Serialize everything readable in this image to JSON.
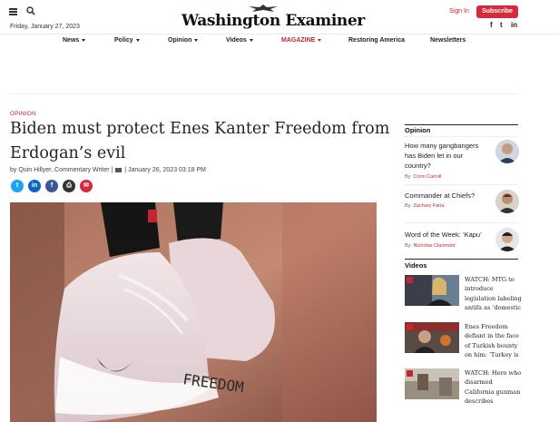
{
  "header": {
    "date": "Friday, January 27, 2023",
    "logo_text": "Washington Examiner",
    "sign_in": "Sign In",
    "subscribe": "Subscribe",
    "social": [
      "f",
      "t",
      "in"
    ]
  },
  "nav": {
    "items": [
      {
        "label": "News",
        "dropdown": true
      },
      {
        "label": "Policy",
        "dropdown": true
      },
      {
        "label": "Opinion",
        "dropdown": true
      },
      {
        "label": "Videos",
        "dropdown": true
      },
      {
        "label": "MAGAZINE",
        "dropdown": true
      },
      {
        "label": "Restoring America",
        "dropdown": false
      },
      {
        "label": "Newsletters",
        "dropdown": false
      }
    ]
  },
  "article": {
    "section": "OPINION",
    "headline": "Biden must protect Enes Kanter Freedom from Erdogan’s evil",
    "byline": "by Quin Hillyer, Commentary Writer |",
    "dateline": "| January 26, 2023 03:18 PM",
    "share": [
      {
        "icon": "twitter-icon",
        "glyph": "t",
        "color": "#1da1f2"
      },
      {
        "icon": "linkedin-icon",
        "glyph": "in",
        "color": "#0a66c2"
      },
      {
        "icon": "facebook-icon",
        "glyph": "f",
        "color": "#3b5998"
      },
      {
        "icon": "print-icon",
        "glyph": "⎙",
        "color": "#333333"
      },
      {
        "icon": "email-icon",
        "glyph": "✉",
        "color": "#d52b3c"
      }
    ],
    "hero_shoe_text": "FREEDOM"
  },
  "sidebar": {
    "opinion_title": "Opinion",
    "opinion": [
      {
        "title": "How many gangbangers has Biden let in our country?",
        "by": "By:",
        "author": "Conn Carroll"
      },
      {
        "title": "Commander at Chiefs?",
        "by": "By:",
        "author": "Zachary Faria"
      },
      {
        "title": "Word of the Week: ‘Kapu’",
        "by": "By:",
        "author": "Nicholas Clairmont"
      }
    ],
    "videos_title": "Videos",
    "videos": [
      {
        "title": "WATCH: MTG to introduce legislation labeling antifa as ‘domestic"
      },
      {
        "title": "Enes Freedom defiant in the face of Turkish bounty on him: ‘Turkey is"
      },
      {
        "title": "WATCH: Hero who disarmed California gunman describes"
      }
    ]
  },
  "colors": {
    "brand_red": "#c8242f",
    "subscribe_bg": "#d52b3c"
  }
}
